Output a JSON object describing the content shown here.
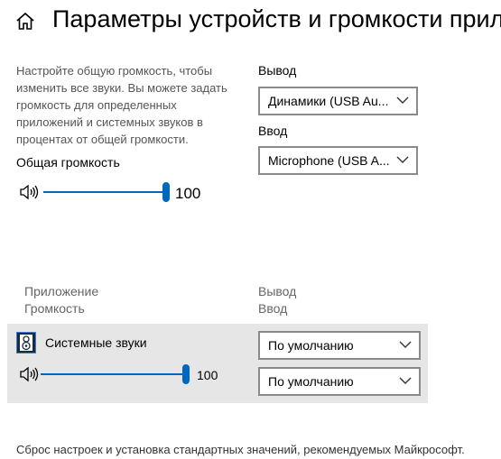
{
  "header": {
    "title": "Параметры устройств и громкости прил",
    "home_icon": "home-icon"
  },
  "master": {
    "description": "Настройте общую громкость, чтобы изменить все звуки. Вы можете задать громкость для определенных приложений и системных звуков в процентах от общей громкости.",
    "volume_label": "Общая громкость",
    "volume_value": "100",
    "volume_level": 100,
    "speaker_icon": "speaker-icon"
  },
  "devices": {
    "output_label": "Вывод",
    "output_value": "Динамики (USB Au...",
    "input_label": "Ввод",
    "input_value": "Microphone (USB A..."
  },
  "apps_table": {
    "col_app": "Приложение",
    "col_volume": "Громкость",
    "col_output": "Вывод",
    "col_input": "Ввод"
  },
  "apps": [
    {
      "name": "Системные звуки",
      "volume_value": "100",
      "volume_level": 100,
      "output_value": "По умолчанию",
      "input_value": "По умолчанию"
    }
  ],
  "footer": {
    "reset_text": "Сброс настроек и установка стандартных значений, рекомендуемых Майкрософт."
  },
  "colors": {
    "accent": "#0067c0",
    "row_background": "#e6e6e6"
  }
}
